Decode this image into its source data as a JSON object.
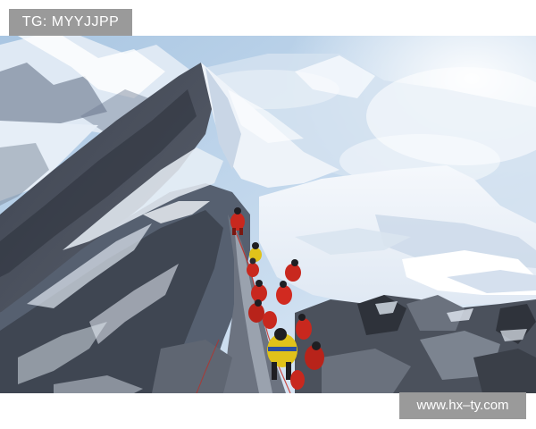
{
  "image": {
    "subject": "mountain-summit-ridge-with-climbers",
    "colors": {
      "sky": "#b9d3ea",
      "haze": "#eef5fb",
      "snow": "#f2f6fb",
      "snow_shadow": "#c7d5e6",
      "rock": "#4a4f5a",
      "rock_dark": "#2d3038",
      "rock_light": "#7d8490",
      "climber_red": "#c8281e",
      "climber_yellow": "#e0c21a"
    }
  },
  "watermarks": {
    "top_left": "TG: MYYJJPP",
    "bottom_right": "www.hx–ty.com"
  }
}
